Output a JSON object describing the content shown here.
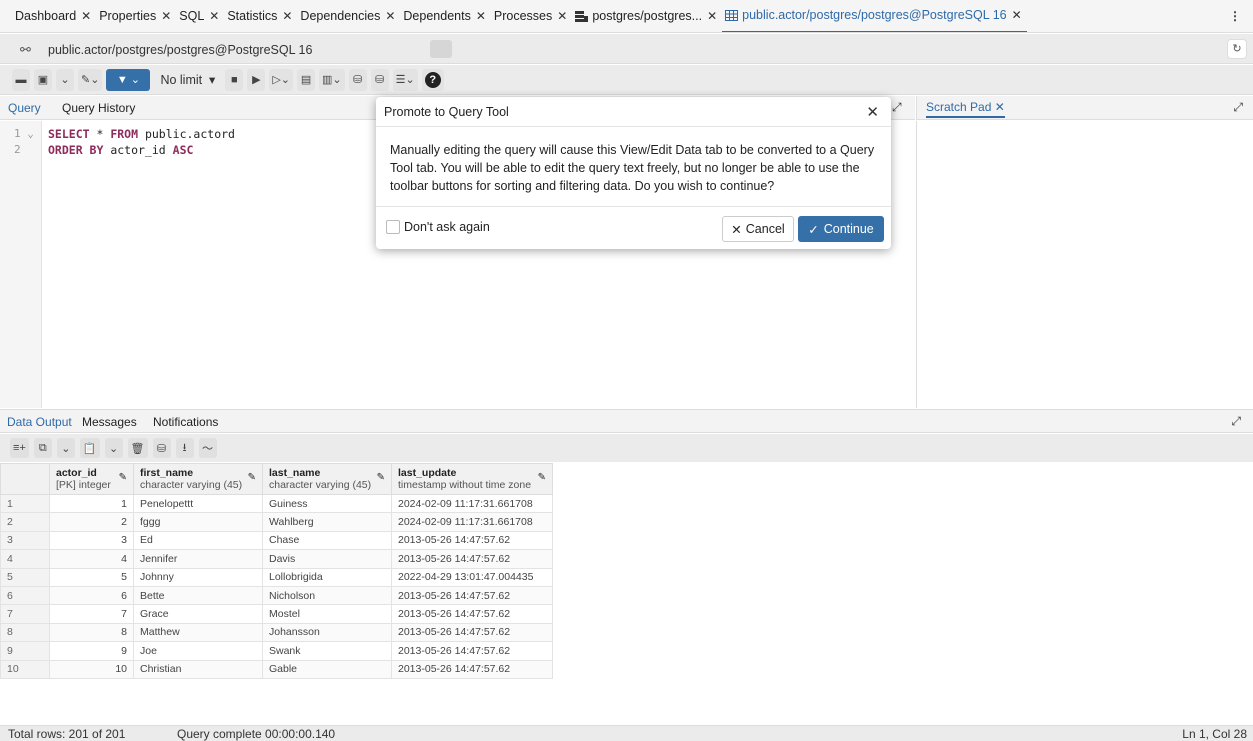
{
  "tabs": [
    {
      "label": "Dashboard",
      "close": "✕"
    },
    {
      "label": "Properties",
      "close": "✕"
    },
    {
      "label": "SQL",
      "close": "✕"
    },
    {
      "label": "Statistics",
      "close": "✕"
    },
    {
      "label": "Dependencies",
      "close": "✕"
    },
    {
      "label": "Dependents",
      "close": "✕"
    },
    {
      "label": "Processes",
      "close": "✕"
    },
    {
      "label": "postgres/postgres...",
      "close": "✕",
      "icon": "database-icon"
    },
    {
      "label": "public.actor/postgres/postgres@PostgreSQL 16",
      "close": "✕",
      "icon": "table-icon",
      "active": true
    }
  ],
  "connection": {
    "label": "public.actor/postgres/postgres@PostgreSQL 16"
  },
  "toolbar": {
    "row_limit": "No limit"
  },
  "editor": {
    "tab_query": "Query",
    "tab_history": "Query History",
    "lines": [
      {
        "num": "1",
        "kw1": "SELECT",
        "mid": " * ",
        "kw2": "FROM",
        "rest": " public.actord"
      },
      {
        "num": "2",
        "kw1": "ORDER BY",
        "rest": " actor_id ",
        "kw2": "ASC"
      }
    ]
  },
  "scratch_pad": {
    "tab": "Scratch Pad",
    "close": "✕"
  },
  "data_output": {
    "tabs": [
      "Data Output",
      "Messages",
      "Notifications"
    ],
    "columns": [
      {
        "name": "actor_id",
        "type": "[PK] integer"
      },
      {
        "name": "first_name",
        "type": "character varying (45)"
      },
      {
        "name": "last_name",
        "type": "character varying (45)"
      },
      {
        "name": "last_update",
        "type": "timestamp without time zone"
      }
    ],
    "rows": [
      [
        "1",
        "1",
        "Penelopettt",
        "Guiness",
        "2024-02-09 11:17:31.661708"
      ],
      [
        "2",
        "2",
        "fggg",
        "Wahlberg",
        "2024-02-09 11:17:31.661708"
      ],
      [
        "3",
        "3",
        "Ed",
        "Chase",
        "2013-05-26 14:47:57.62"
      ],
      [
        "4",
        "4",
        "Jennifer",
        "Davis",
        "2013-05-26 14:47:57.62"
      ],
      [
        "5",
        "5",
        "Johnny",
        "Lollobrigida",
        "2022-04-29 13:01:47.004435"
      ],
      [
        "6",
        "6",
        "Bette",
        "Nicholson",
        "2013-05-26 14:47:57.62"
      ],
      [
        "7",
        "7",
        "Grace",
        "Mostel",
        "2013-05-26 14:47:57.62"
      ],
      [
        "8",
        "8",
        "Matthew",
        "Johansson",
        "2013-05-26 14:47:57.62"
      ],
      [
        "9",
        "9",
        "Joe",
        "Swank",
        "2013-05-26 14:47:57.62"
      ],
      [
        "10",
        "10",
        "Christian",
        "Gable",
        "2013-05-26 14:47:57.62"
      ]
    ]
  },
  "status": {
    "total_rows": "Total rows: 201 of 201",
    "query_status": "Query complete 00:00:00.140",
    "cursor": "Ln 1, Col 28"
  },
  "modal": {
    "title": "Promote to Query Tool",
    "close": "✕",
    "message": "Manually editing the query will cause this View/Edit Data tab to be converted to a Query Tool tab. You will be able to edit the query text freely, but no longer be able to use the toolbar buttons for sorting and filtering data. Do you wish to continue?",
    "checkbox_label": "Don't ask again",
    "cancel_label": "Cancel",
    "continue_label": "Continue"
  },
  "colors": {
    "accent": "#3570a8",
    "keyword": "#8e2a5c"
  }
}
